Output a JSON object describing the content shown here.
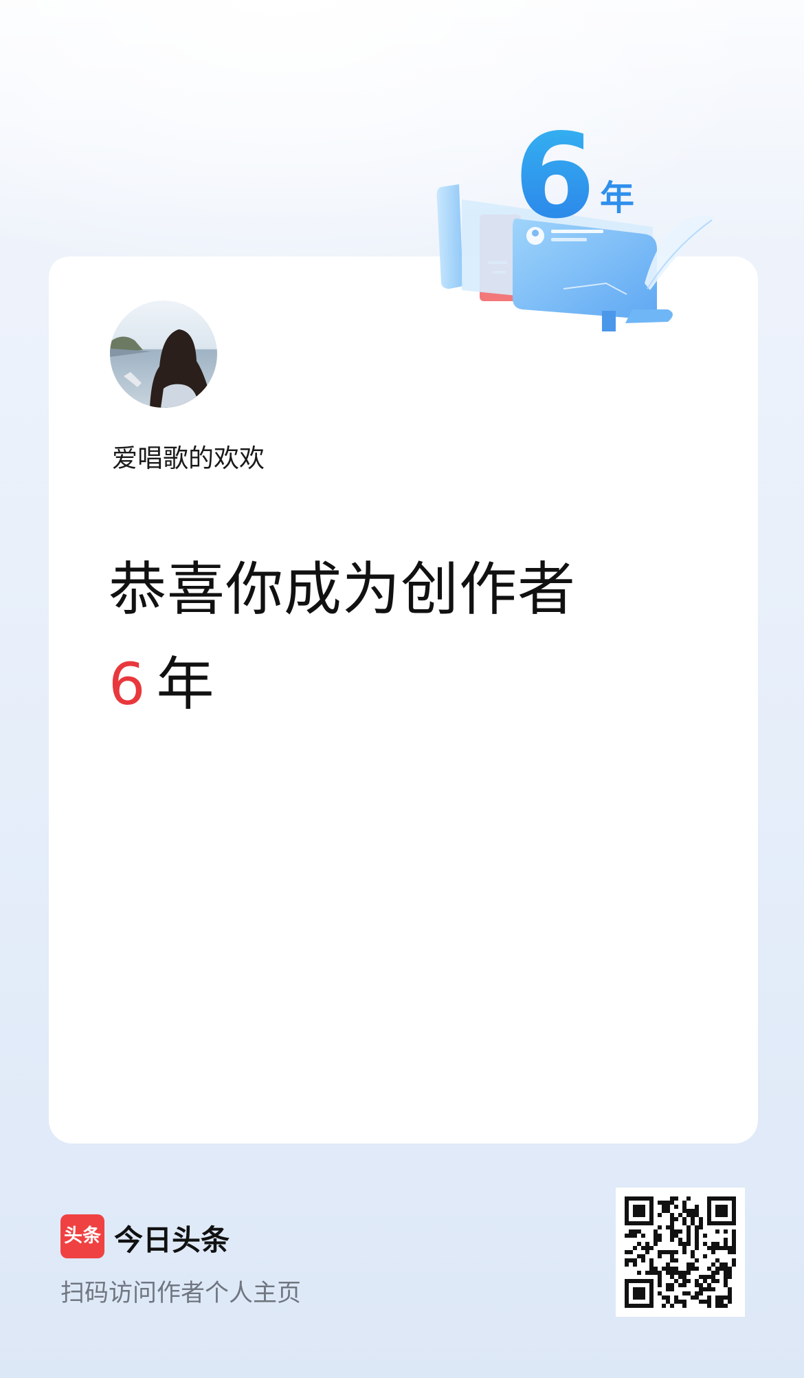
{
  "profile": {
    "username": "爱唱歌的欢欢"
  },
  "banner": {
    "illustration_number": "6",
    "illustration_unit": "年"
  },
  "headline": {
    "line1": "恭喜你成为创作者",
    "years_number": "6",
    "years_unit": "年"
  },
  "footer": {
    "logo_text": "头条",
    "brand_name": "今日头条",
    "scan_hint": "扫码访问作者个人主页"
  },
  "colors": {
    "accent_red": "#e8383d",
    "logo_red": "#f04142",
    "illustration_blue": "#3aa0f0"
  },
  "icons": [
    "anniversary-6-year-illustration",
    "avatar-photo",
    "toutiao-logo-icon",
    "qr-code"
  ]
}
